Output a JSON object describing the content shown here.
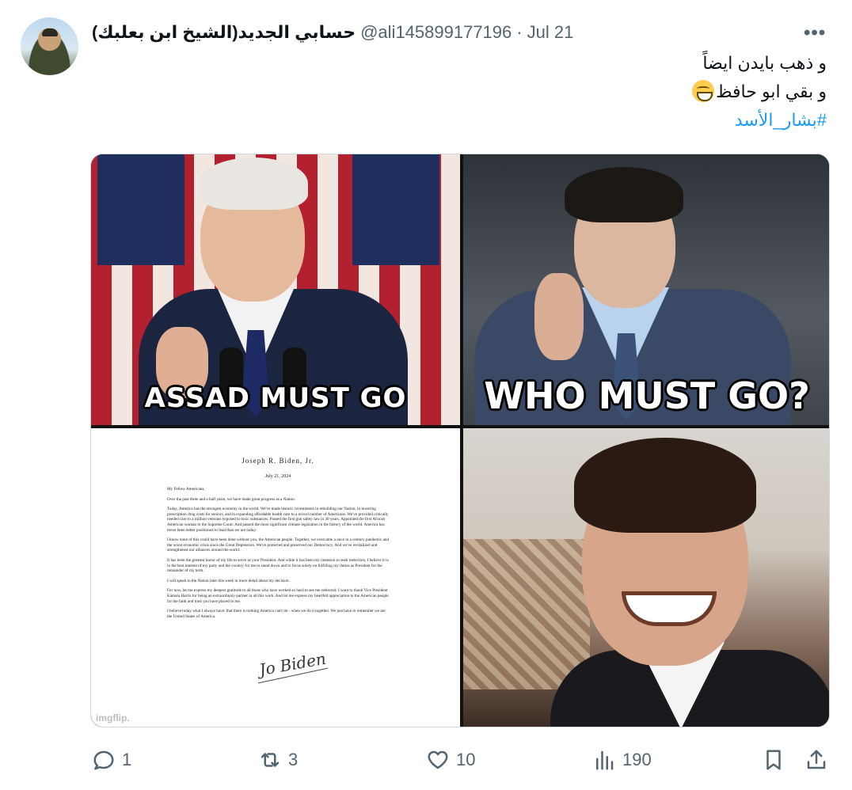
{
  "tweet": {
    "display_name": "حسابي الجديد(الشيخ ابن بعلبك)",
    "handle": "@ali145899177196",
    "separator": "·",
    "date": "Jul 21",
    "more_label": "•••",
    "text_lines": [
      "و ذهب بايدن ايضاً",
      "و بقي ابو حافظ"
    ],
    "emoji": "grinning-face-with-smiling-eyes",
    "hashtag": "#بشار_الأسد"
  },
  "media": {
    "panels": [
      {
        "name": "biden",
        "caption": "ASSAD MUST GO"
      },
      {
        "name": "assad-ear",
        "caption": "WHO MUST GO?"
      },
      {
        "name": "letter",
        "watermark": "imgflip."
      },
      {
        "name": "assad-laughing"
      }
    ],
    "letter": {
      "heading": "Joseph R. Biden, Jr.",
      "date": "July 21, 2024",
      "greeting": "My Fellow Americans,",
      "paragraphs": [
        "Over the past three and a half years, we have made great progress as a Nation.",
        "Today, America has the strongest economy in the world. We've made historic investments in rebuilding our Nation, in lowering prescription drug costs for seniors, and in expanding affordable health care to a record number of Americans. We've provided critically needed care to a million veterans exposed to toxic substances. Passed the first gun safety law in 30 years. Appointed the first African American woman to the Supreme Court. And passed the most significant climate legislation in the history of the world. America has never been better positioned to lead than we are today.",
        "I know none of this could have been done without you, the American people. Together, we overcame a once in a century pandemic and the worst economic crisis since the Great Depression. We've protected and preserved our Democracy. And we've revitalized and strengthened our alliances around the world.",
        "It has been the greatest honor of my life to serve as your President. And while it has been my intention to seek reelection, I believe it is in the best interest of my party and the country for me to stand down and to focus solely on fulfilling my duties as President for the remainder of my term.",
        "I will speak to the Nation later this week in more detail about my decision.",
        "For now, let me express my deepest gratitude to all those who have worked so hard to see me reelected. I want to thank Vice President Kamala Harris for being an extraordinary partner in all this work. And let me express my heartfelt appreciation to the American people for the faith and trust you have placed in me.",
        "I believe today what I always have: that there is nothing America can't do - when we do it together. We just have to remember we are the United States of America."
      ],
      "signature": "Jo Biden"
    }
  },
  "actions": {
    "replies": "1",
    "reposts": "3",
    "likes": "10",
    "views": "190"
  }
}
